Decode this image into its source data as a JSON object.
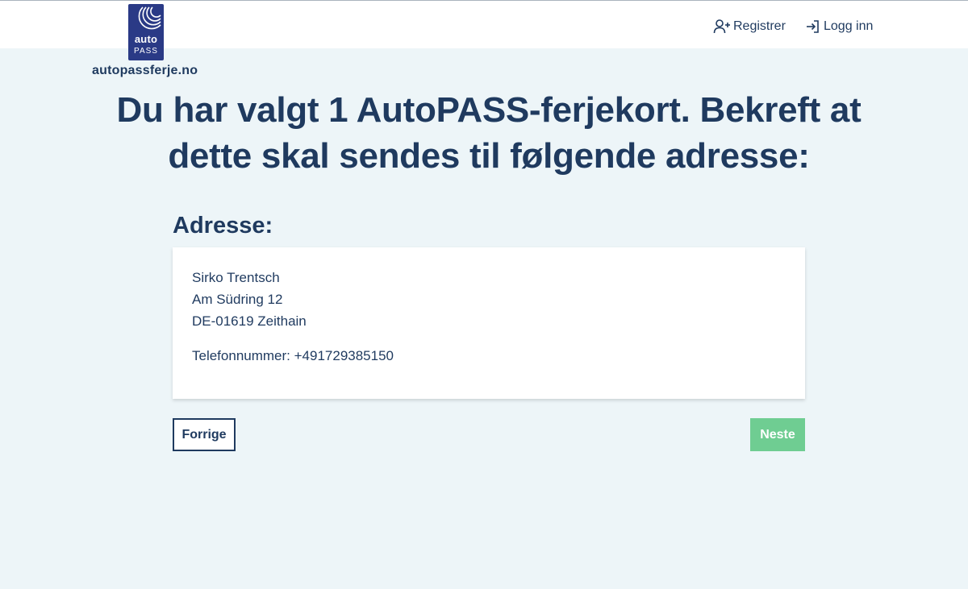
{
  "header": {
    "logo_top": "auto",
    "logo_bottom": "PASS",
    "site_name": "autopassferje.no",
    "nav": {
      "register_label": "Registrer",
      "login_label": "Logg inn"
    }
  },
  "main": {
    "title": "Du har valgt 1 AutoPASS-ferjekort. Bekreft at dette skal sendes til følgende adresse:",
    "address_heading": "Adresse:",
    "address": {
      "name": "Sirko Trentsch",
      "street": "Am Südring 12",
      "postal_city": "DE-01619 Zeithain",
      "phone_line": "Telefonnummer: +491729385150"
    },
    "buttons": {
      "previous_label": "Forrige",
      "next_label": "Neste"
    }
  },
  "colors": {
    "background": "#edf5f8",
    "primary_text": "#1f3a5f",
    "logo_blue": "#2a3a86",
    "next_button": "#6fcd92"
  },
  "icons": {
    "register": "user-plus-icon",
    "login": "login-icon",
    "logo_signal": "signal-waves-icon"
  }
}
